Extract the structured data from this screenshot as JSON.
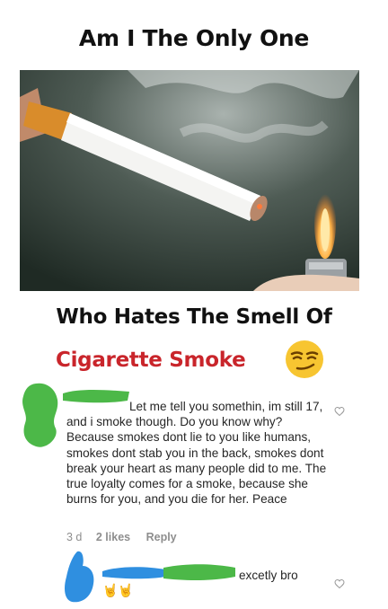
{
  "header": {
    "line1": "Am I The Only One",
    "line2": "Who Hates The Smell Of",
    "line3": "Cigarette Smoke"
  },
  "comment": {
    "text": "Let me tell you somethin, im still 17, and i smoke though. Do you know why? Because smokes dont lie to you like humans, smokes dont stab you in the back, smokes dont break your heart as many people did to me. The true loyalty comes for a smoke, because she burns for you, and you die for her. Peace",
    "time": "3 d",
    "likes": "2 likes",
    "reply_label": "Reply"
  },
  "reply": {
    "text": "excetly bro",
    "emoji": "🤘🤘"
  },
  "icons": {
    "like": "heart-outline-icon",
    "title_emoji": "smirking-face-emoji"
  },
  "colors": {
    "headline_red": "#c9252b",
    "censor_green": "#4cb848",
    "censor_blue": "#2f8fe0",
    "meta_gray": "#8e8e8e"
  }
}
